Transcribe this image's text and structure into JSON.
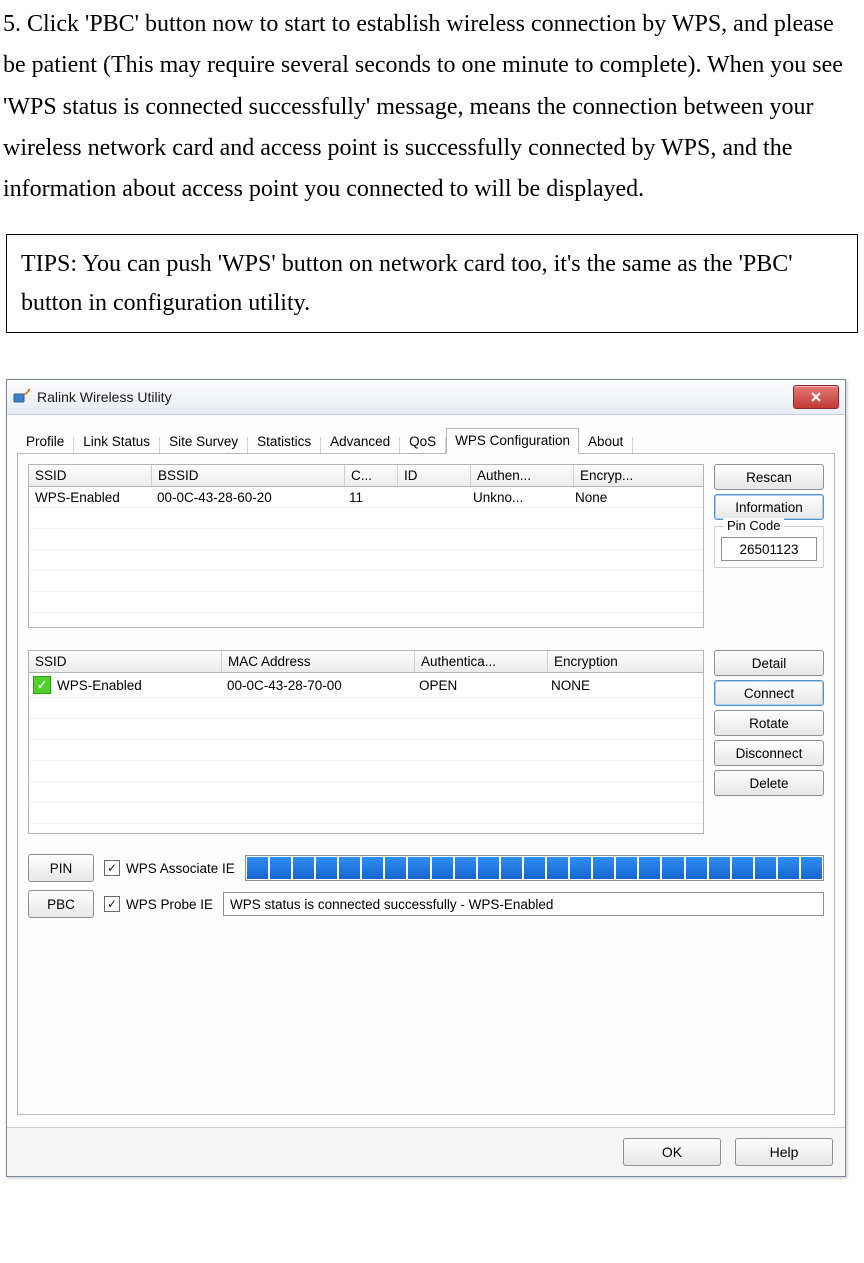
{
  "doc": {
    "paragraph": "5. Click 'PBC' button now to start to establish wireless connection by WPS, and please be patient (This may require several seconds to one minute to complete). When you see 'WPS status is connected successfully' message, means the connection between your wireless network card and access point is successfully connected by WPS, and the information about access point you connected to will be displayed.",
    "tips": "TIPS: You can push 'WPS' button on network card too, it's the same as the 'PBC' button in configuration utility."
  },
  "window": {
    "title": "Ralink Wireless Utility",
    "tabs": [
      "Profile",
      "Link Status",
      "Site Survey",
      "Statistics",
      "Advanced",
      "QoS",
      "WPS Configuration",
      "About"
    ],
    "active_tab": "WPS Configuration",
    "grid1": {
      "headers": [
        "SSID",
        "BSSID",
        "C...",
        "ID",
        "Authen...",
        "Encryp..."
      ],
      "row": {
        "ssid": "WPS-Enabled",
        "bssid": "00-0C-43-28-60-20",
        "ch": "11",
        "id": "",
        "auth": "Unkno...",
        "enc": "None"
      }
    },
    "side1": {
      "rescan": "Rescan",
      "information": "Information",
      "pin_group": "Pin Code",
      "pin_value": "26501123"
    },
    "grid2": {
      "headers": [
        "SSID",
        "MAC Address",
        "Authentica...",
        "Encryption"
      ],
      "row": {
        "ssid": "WPS-Enabled",
        "mac": "00-0C-43-28-70-00",
        "auth": "OPEN",
        "enc": "NONE"
      }
    },
    "side2": {
      "detail": "Detail",
      "connect": "Connect",
      "rotate": "Rotate",
      "disconnect": "Disconnect",
      "delete": "Delete"
    },
    "buttons": {
      "pin": "PIN",
      "pbc": "PBC"
    },
    "check1": "WPS Associate IE",
    "check2": "WPS Probe IE",
    "status": "WPS status is connected successfully - WPS-Enabled",
    "footer": {
      "ok": "OK",
      "help": "Help"
    }
  }
}
